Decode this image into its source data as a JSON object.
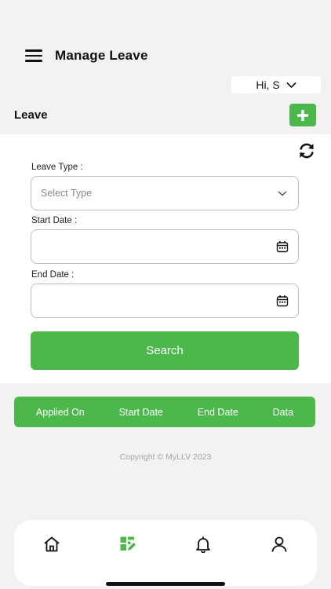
{
  "header": {
    "title": "Manage Leave"
  },
  "user": {
    "greeting": "Hi, S"
  },
  "section": {
    "title": "Leave"
  },
  "form": {
    "leave_type_label": "Leave Type :",
    "leave_type_placeholder": "Select Type",
    "start_date_label": "Start Date :",
    "start_date_value": "",
    "end_date_label": "End Date :",
    "end_date_value": "",
    "search_label": "Search"
  },
  "table": {
    "columns": [
      "Applied On",
      "Start Date",
      "End Date",
      "Data"
    ]
  },
  "footer": {
    "copyright": "Copyright © MyLLV 2023"
  },
  "colors": {
    "accent": "#4cb84c",
    "background": "#f4f1f5"
  },
  "bottom_nav": {
    "items": [
      {
        "icon": "home-icon",
        "active": false
      },
      {
        "icon": "leave-edit-icon",
        "active": true
      },
      {
        "icon": "bell-icon",
        "active": false
      },
      {
        "icon": "user-icon",
        "active": false
      }
    ]
  }
}
